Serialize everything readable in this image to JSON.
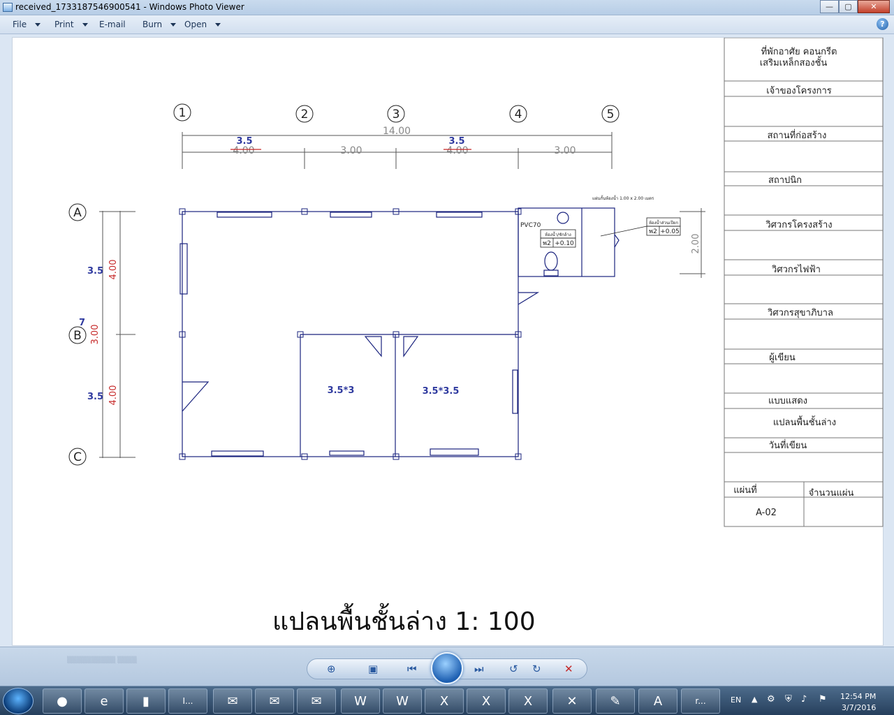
{
  "window": {
    "title": "received_1733187546900541 - Windows Photo Viewer",
    "min": "—",
    "max": "▢",
    "close": "✕"
  },
  "menu": {
    "file": "File",
    "print": "Print",
    "email": "E-mail",
    "burn": "Burn",
    "open": "Open",
    "help": "?"
  },
  "drawing": {
    "grid_cols": [
      "1",
      "2",
      "3",
      "4",
      "5"
    ],
    "grid_rows": [
      "A",
      "B",
      "C"
    ],
    "dim_total": "14.00",
    "dim_top": [
      "4.00",
      "3.00",
      "4.00",
      "3.00"
    ],
    "dim_top_new": [
      "3.5",
      "3.5"
    ],
    "dim_side": [
      "4.00",
      "3.00",
      "4.00"
    ],
    "dim_side_new": [
      "3.5",
      "7",
      "3.5"
    ],
    "room1": "3.5*3",
    "room2": "3.5*3.5",
    "pvc": "PVC70",
    "bath_note": "แผ่นกั้นห้องน้ำ 1.00 x 2.00 เมตร",
    "bath_label": "ห้องน้ำ/ซักล้าง",
    "bath_code": "พ2",
    "bath_level": "+0.10",
    "wet_label": "ห้องน้ำส่วนเปียก",
    "wet_code": "พ2",
    "wet_level": "+0.05",
    "bath_dim": "2.00",
    "caption": "แปลนพื้นชั้นล่าง  1: 100"
  },
  "titleblock": {
    "project": "ที่พักอาศัย คอนกรีต",
    "project2": "เสริมเหล็กสองชั้น",
    "owner": "เจ้าของโครงการ",
    "site": "สถานที่ก่อสร้าง",
    "architect": "สถาปนิก",
    "structural": "วิศวกรโครงสร้าง",
    "electrical": "วิศวกรไฟฟ้า",
    "sanitary": "วิศวกรสุขาภิบาล",
    "drafter": "ผู้เขียน",
    "shows": "แบบแสดง",
    "shows_value": "แปลนพื้นชั้นล่าง",
    "date": "วันที่เขียน",
    "sheet": "แผ่นที่",
    "count": "จำนวนแผ่น",
    "sheet_no": "A-02"
  },
  "taskbar": {
    "active_item": "I...",
    "viewer_item": "r...",
    "lang": "EN",
    "time": "12:54 PM",
    "date": "3/7/2016"
  },
  "colors": {
    "plan_line": "#1a237e",
    "blue_text": "#2f3a9f",
    "red_mark": "#c62828"
  }
}
